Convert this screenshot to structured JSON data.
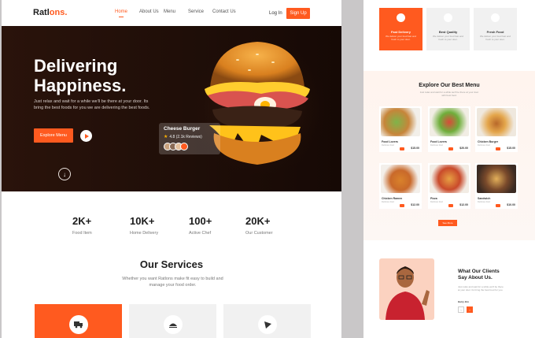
{
  "brand": {
    "name": "Ratl",
    "name2": "ons",
    "dot": "."
  },
  "nav": {
    "links": [
      "Home",
      "About Us",
      "Menu",
      "Service",
      "Contact Us"
    ],
    "login": "Log In",
    "signup": "Sign Up"
  },
  "hero": {
    "title_line1": "Delivering",
    "title_line2": "Happiness.",
    "desc": "Just relax and wait for a while we'll be there at your door. Its bring the best foods for you we are delivering the best foods.",
    "explore_label": "Explore Menu",
    "card_title": "Cheese Burger",
    "card_rating": "4.8 (2.1k Reviews)"
  },
  "stats": [
    {
      "num": "2K+",
      "label": "Food Item"
    },
    {
      "num": "10K+",
      "label": "Home Delivery"
    },
    {
      "num": "100+",
      "label": "Active Chef"
    },
    {
      "num": "20K+",
      "label": "Our Customer"
    }
  ],
  "services": {
    "title": "Our Services",
    "desc": "Whether you want Ratlons make fit easy to build and manage your food order."
  },
  "right_cards": [
    {
      "title": "Fast Delivery",
      "desc": "We deliver your food fast and fresh to your door."
    },
    {
      "title": "Best Quality",
      "desc": "We deliver your food fast and fresh to your door."
    },
    {
      "title": "Fresh Food",
      "desc": "We deliver your food fast and fresh to your door."
    }
  ],
  "menu": {
    "title": "Explore Our Best Menu",
    "desc": "Just relax and wait for a while we'll be there at your door with best food.",
    "dishes": [
      {
        "name": "Food Lovers",
        "desc": "Delicious food",
        "price": "$15.00"
      },
      {
        "name": "Food Lovers",
        "desc": "Delicious food",
        "price": "$20.00"
      },
      {
        "name": "Chicken Burger",
        "desc": "Delicious food",
        "price": "$15.00"
      },
      {
        "name": "Chicken Ramen",
        "desc": "Delicious food",
        "price": "$12.00"
      },
      {
        "name": "Pizza",
        "desc": "Delicious food",
        "price": "$12.00"
      },
      {
        "name": "Sandwich",
        "desc": "Delicious food",
        "price": "$10.00"
      }
    ],
    "see_all": "See More"
  },
  "testimonial": {
    "title_line1": "What Our Clients",
    "title_line2": "Say About Us.",
    "text": "Just relax and wait for a while we'll be there at your door. Its bring the best food for you.",
    "name": "Harry Jim"
  },
  "colors": {
    "accent": "#ff5a1f",
    "dark": "#1f0e08"
  }
}
